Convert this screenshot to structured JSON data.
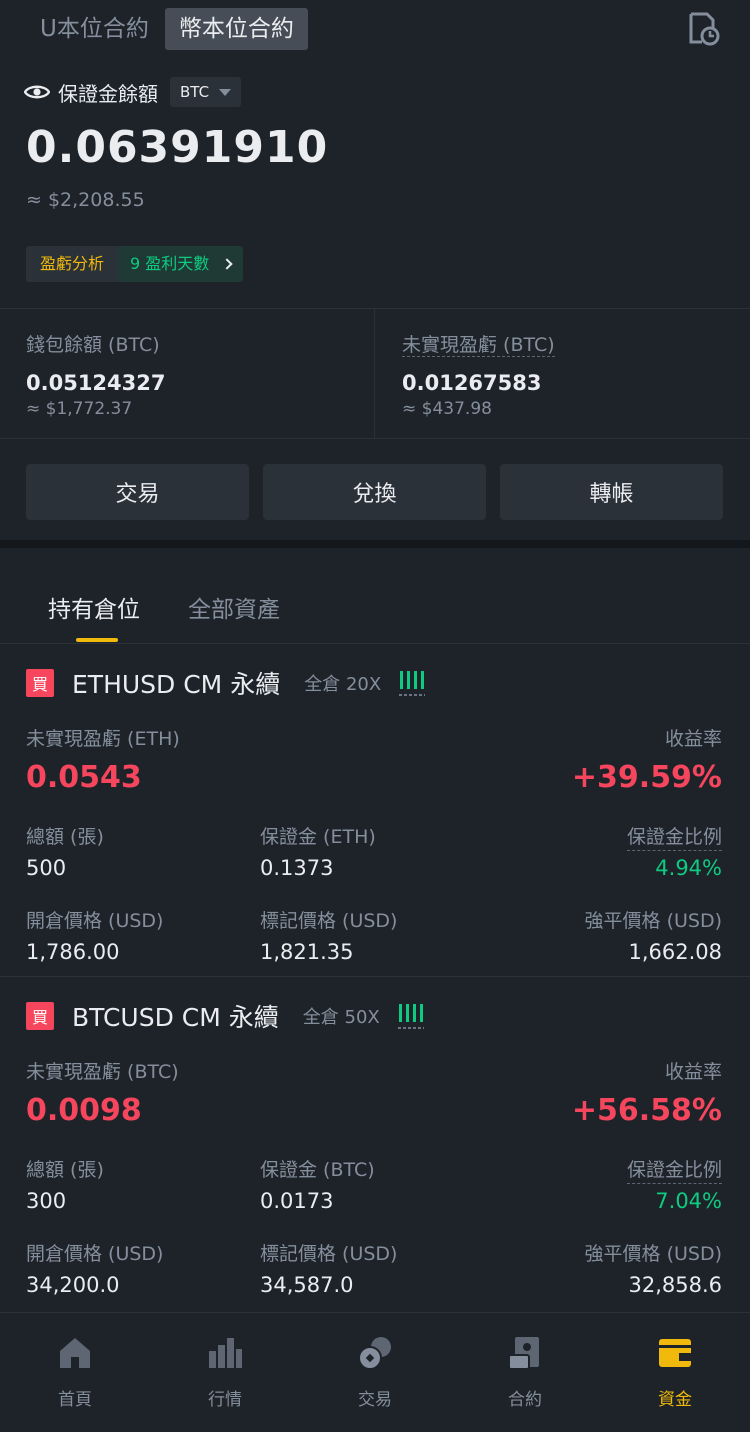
{
  "top_tabs": [
    "U本位合約",
    "幣本位合約"
  ],
  "active_top_tab": "幣本位合約",
  "margin": {
    "label": "保證金餘額",
    "asset": "BTC",
    "value": "0.06391910",
    "usd": "≈ $2,208.55"
  },
  "pnl": {
    "analysis_label": "盈虧分析",
    "days_label": "9 盈利天數"
  },
  "wallet": {
    "label": "錢包餘額 (BTC)",
    "value": "0.05124327",
    "usd": "≈ $1,772.37"
  },
  "unrealized": {
    "label": "未實現盈虧 (BTC)",
    "value": "0.01267583",
    "usd": "≈ $437.98"
  },
  "actions": [
    "交易",
    "兌換",
    "轉帳"
  ],
  "sub_tabs": [
    "持有倉位",
    "全部資產"
  ],
  "active_sub_tab": "持有倉位",
  "positions": [
    {
      "side": "買",
      "symbol": "ETHUSD CM 永續",
      "mode": "全倉 20X",
      "pnl_label": "未實現盈虧 (ETH)",
      "pnl_value": "0.0543",
      "roe_label": "收益率",
      "roe_value": "+39.59%",
      "size_label": "總額 (張)",
      "size_value": "500",
      "margin_label": "保證金 (ETH)",
      "margin_value": "0.1373",
      "ratio_label": "保證金比例",
      "ratio_value": "4.94%",
      "entry_label": "開倉價格 (USD)",
      "entry_value": "1,786.00",
      "mark_label": "標記價格 (USD)",
      "mark_value": "1,821.35",
      "liq_label": "強平價格 (USD)",
      "liq_value": "1,662.08"
    },
    {
      "side": "買",
      "symbol": "BTCUSD CM 永續",
      "mode": "全倉 50X",
      "pnl_label": "未實現盈虧 (BTC)",
      "pnl_value": "0.0098",
      "roe_label": "收益率",
      "roe_value": "+56.58%",
      "size_label": "總額 (張)",
      "size_value": "300",
      "margin_label": "保證金 (BTC)",
      "margin_value": "0.0173",
      "ratio_label": "保證金比例",
      "ratio_value": "7.04%",
      "entry_label": "開倉價格 (USD)",
      "entry_value": "34,200.0",
      "mark_label": "標記價格 (USD)",
      "mark_value": "34,587.0",
      "liq_label": "強平價格 (USD)",
      "liq_value": "32,858.6"
    }
  ],
  "bottom_nav": [
    {
      "label": "首頁",
      "icon": "home-icon"
    },
    {
      "label": "行情",
      "icon": "markets-icon"
    },
    {
      "label": "交易",
      "icon": "trade-icon"
    },
    {
      "label": "合約",
      "icon": "futures-icon"
    },
    {
      "label": "資金",
      "icon": "wallet-icon"
    }
  ],
  "active_nav": "資金",
  "colors": {
    "background": "#1e2329",
    "panel": "#2b3139",
    "accent": "#f0b90b",
    "up": "#0ecb81",
    "down": "#f6465d",
    "muted": "#848e9c"
  }
}
